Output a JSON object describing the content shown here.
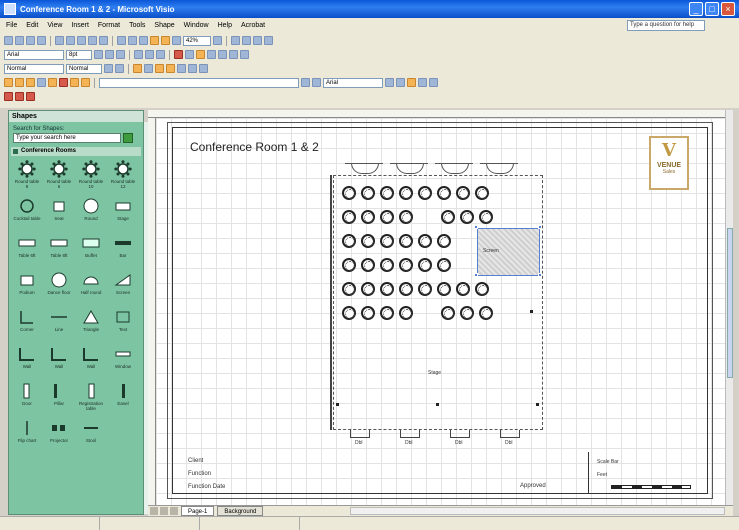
{
  "window": {
    "title": "Conference Room 1 & 2 - Microsoft Visio"
  },
  "menu": {
    "items": [
      "File",
      "Edit",
      "View",
      "Insert",
      "Format",
      "Tools",
      "Shape",
      "Window",
      "Help",
      "Acrobat"
    ],
    "help_placeholder": "Type a question for help"
  },
  "toolbar": {
    "font_name": "Arial",
    "font_size": "8pt",
    "zoom": "42%",
    "style": "Normal",
    "line_style": "Normal"
  },
  "shapes_panel": {
    "header": "Shapes",
    "search_label": "Search for Shapes:",
    "search_placeholder": "Type your search here",
    "stencil_name": "Conference Rooms",
    "items": [
      {
        "label": "Round table 8",
        "icon": "round-table-icon"
      },
      {
        "label": "Round table 6",
        "icon": "round-table-icon"
      },
      {
        "label": "Round table 10",
        "icon": "round-table-icon"
      },
      {
        "label": "Round table 12",
        "icon": "round-table-icon"
      },
      {
        "label": "Cocktail table",
        "icon": "cocktail-table-icon"
      },
      {
        "label": "Seat",
        "icon": "seat-icon"
      },
      {
        "label": "Round",
        "icon": "circle-icon"
      },
      {
        "label": "Stage",
        "icon": "stage-icon"
      },
      {
        "label": "Table 6ft",
        "icon": "rect-table-icon"
      },
      {
        "label": "Table 8ft",
        "icon": "rect-table-icon"
      },
      {
        "label": "Buffet",
        "icon": "buffet-icon"
      },
      {
        "label": "Bar",
        "icon": "bar-icon"
      },
      {
        "label": "Podium",
        "icon": "podium-icon"
      },
      {
        "label": "Dance floor",
        "icon": "dance-floor-icon"
      },
      {
        "label": "Half round",
        "icon": "half-round-icon"
      },
      {
        "label": "Screen",
        "icon": "screen-icon"
      },
      {
        "label": "Corner",
        "icon": "corner-icon"
      },
      {
        "label": "Line",
        "icon": "line-icon"
      },
      {
        "label": "Triangle",
        "icon": "triangle-icon"
      },
      {
        "label": "Text",
        "icon": "text-icon"
      },
      {
        "label": "Wall",
        "icon": "wall-icon"
      },
      {
        "label": "Wall",
        "icon": "wall-icon"
      },
      {
        "label": "Wall",
        "icon": "wall-icon"
      },
      {
        "label": "Window",
        "icon": "window-icon"
      },
      {
        "label": "Door",
        "icon": "door-icon"
      },
      {
        "label": "Pillar",
        "icon": "pillar-icon"
      },
      {
        "label": "Registration table",
        "icon": "registration-icon"
      },
      {
        "label": "Easel",
        "icon": "easel-icon"
      },
      {
        "label": "Flip chart",
        "icon": "flip-chart-icon"
      },
      {
        "label": "Projector",
        "icon": "projector-icon"
      },
      {
        "label": "Stool",
        "icon": "stool-icon"
      }
    ]
  },
  "drawing": {
    "room_title": "Conference Room 1 & 2",
    "logo_text": "VENUE",
    "logo_sub": "Sales",
    "screen_label": "Screen",
    "center_label": "Stage",
    "door_labels": [
      "Dbl",
      "Dbl",
      "Dbl",
      "Dbl"
    ],
    "client_label": "Client",
    "function_label": "Function",
    "function_date_label": "Function Date",
    "approval_label": "Approved",
    "scale_title": "Scale Bar",
    "scale_sub": "Feet"
  },
  "tabs": {
    "active": "Page-1",
    "inactive": "Background"
  }
}
